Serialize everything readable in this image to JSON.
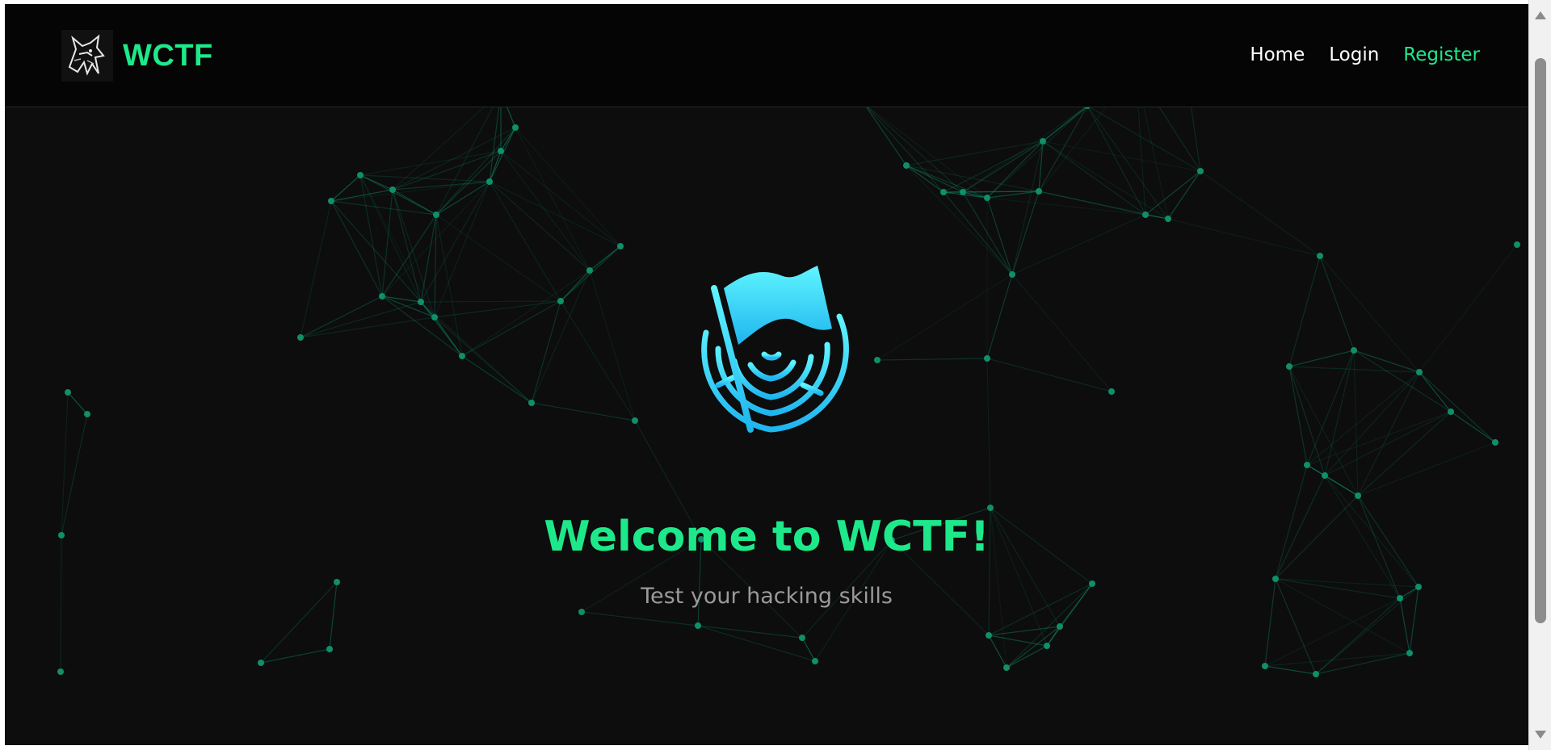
{
  "brand": {
    "name": "WCTF",
    "logo_icon": "wolf-icon"
  },
  "nav": {
    "home": "Home",
    "login": "Login",
    "register": "Register",
    "active": "register"
  },
  "hero": {
    "icon": "flag-maze-icon",
    "title": "Welcome to WCTF!",
    "subtitle": "Test your hacking skills"
  },
  "colors": {
    "accent": "#1de98b",
    "network": "#0f8f6a",
    "icon_top": "#5ff5ff",
    "icon_bottom": "#1fb5ef",
    "background": "#0d0d0d"
  }
}
